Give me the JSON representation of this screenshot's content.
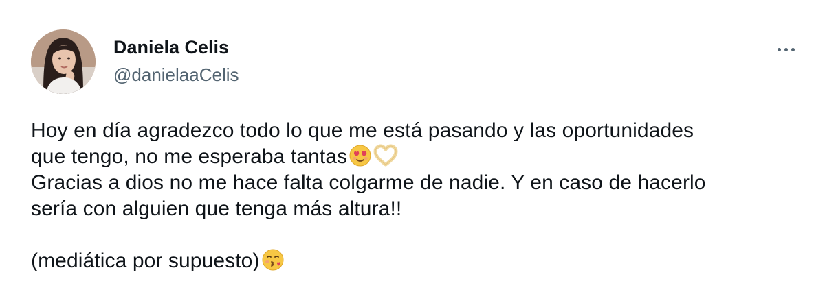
{
  "author": {
    "name": "Daniela Celis",
    "handle": "@danielaaCelis"
  },
  "icons": {
    "more": "more-options-icon",
    "emoji_1": "smiling-face-with-heart-eyes-emoji",
    "emoji_2": "heart-hands-emoji",
    "emoji_3": "face-blowing-kiss-emoji"
  },
  "tweet": {
    "line1": "Hoy en día agradezco todo lo que me está pasando y las oportunidades",
    "line2": "que tengo, no me esperaba tantas",
    "line3": "Gracias a dios no me hace falta colgarme de nadie. Y en caso de hacerlo",
    "line4": "sería con alguien que tenga más altura!!",
    "line5": "(mediática por supuesto)"
  },
  "colors": {
    "text": "#0f1419",
    "secondary": "#536471",
    "background": "#ffffff"
  }
}
